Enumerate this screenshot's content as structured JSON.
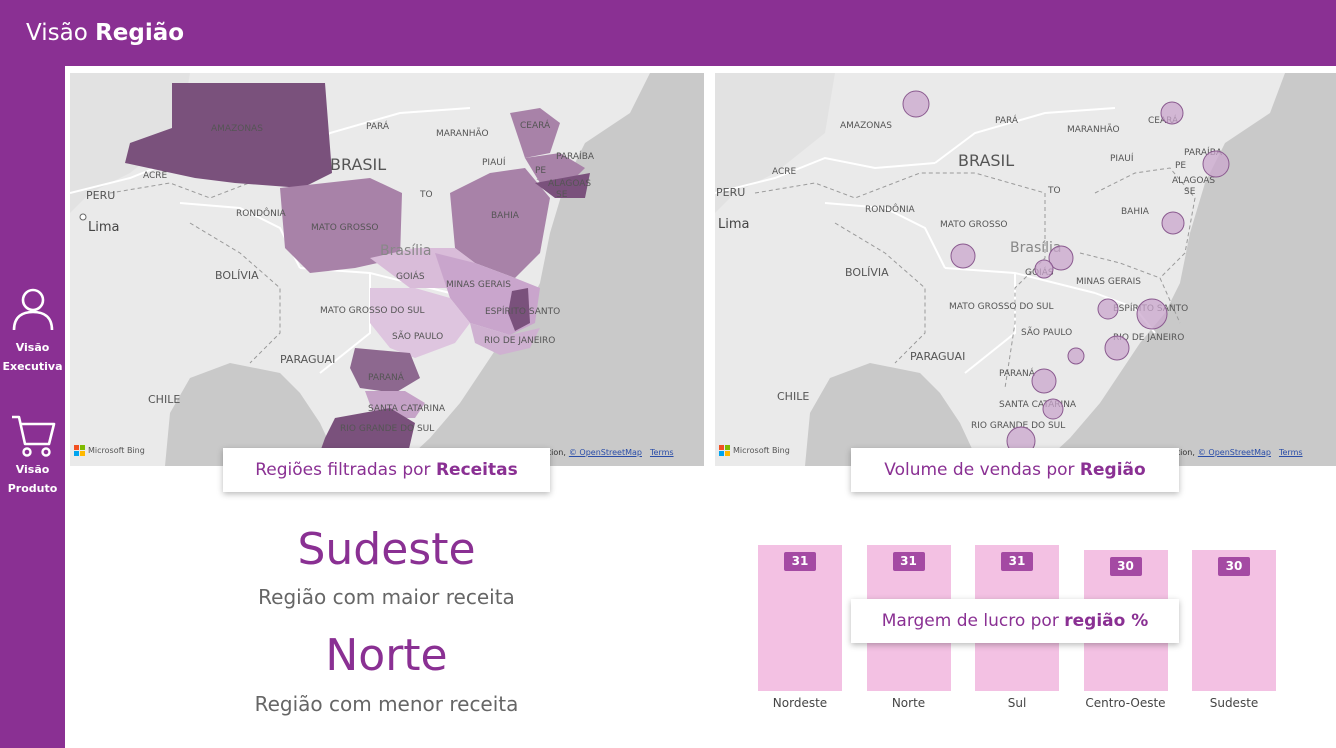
{
  "header": {
    "title_prefix": "Visão",
    "title_bold": "Região"
  },
  "sidebar": {
    "items": [
      {
        "line1": "Visão",
        "line2": "Executiva",
        "icon": "person-icon"
      },
      {
        "line1": "Visão",
        "line2": "Produto",
        "icon": "cart-icon"
      }
    ]
  },
  "map_labels": {
    "country": "BRASIL",
    "capital": "Brasília",
    "city": "Lima",
    "states": [
      "AMAZONAS",
      "PARÁ",
      "MARANHÃO",
      "CEARÁ",
      "PARAÍBA",
      "PIAUÍ",
      "PE",
      "ALAGOAS",
      "SE",
      "ACRE",
      "TO",
      "RONDÔNIA",
      "MATO GROSSO",
      "BAHIA",
      "GOIÁS",
      "MINAS GERAIS",
      "ESPÍRITO SANTO",
      "MATO GROSSO DO SUL",
      "SÃO PAULO",
      "RIO DE JANEIRO",
      "PARANÁ",
      "SANTA CATARINA",
      "RIO GRANDE DO SUL"
    ],
    "countries": [
      "PERU",
      "BOLÍVIA",
      "PARAGUAI",
      "CHILE"
    ]
  },
  "map1": {
    "caption_prefix": "Regiões filtradas por",
    "caption_bold": "Receitas",
    "bing": "Microsoft Bing",
    "attribution": "tion,",
    "osm": "© OpenStreetMap",
    "terms": "Terms"
  },
  "map2": {
    "caption_prefix": "Volume de vendas por",
    "caption_bold": "Região",
    "bing": "Microsoft Bing",
    "attribution": "tion,",
    "osm": "© OpenStreetMap",
    "terms": "Terms"
  },
  "kpis": [
    {
      "value": "Sudeste",
      "label": "Região com maior receita"
    },
    {
      "value": "Norte",
      "label": "Região com menor receita"
    }
  ],
  "bar_caption": {
    "prefix": "Margem de lucro por",
    "bold": "região %"
  },
  "colors": {
    "brand": "#8a3093",
    "bar": "#f3c1e3",
    "badge": "#a44aa3"
  },
  "chart_data": {
    "type": "bar",
    "categories": [
      "Nordeste",
      "Norte",
      "Sul",
      "Centro-Oeste",
      "Sudeste"
    ],
    "values": [
      31,
      31,
      31,
      30,
      30
    ],
    "ylim": [
      0,
      31
    ]
  }
}
